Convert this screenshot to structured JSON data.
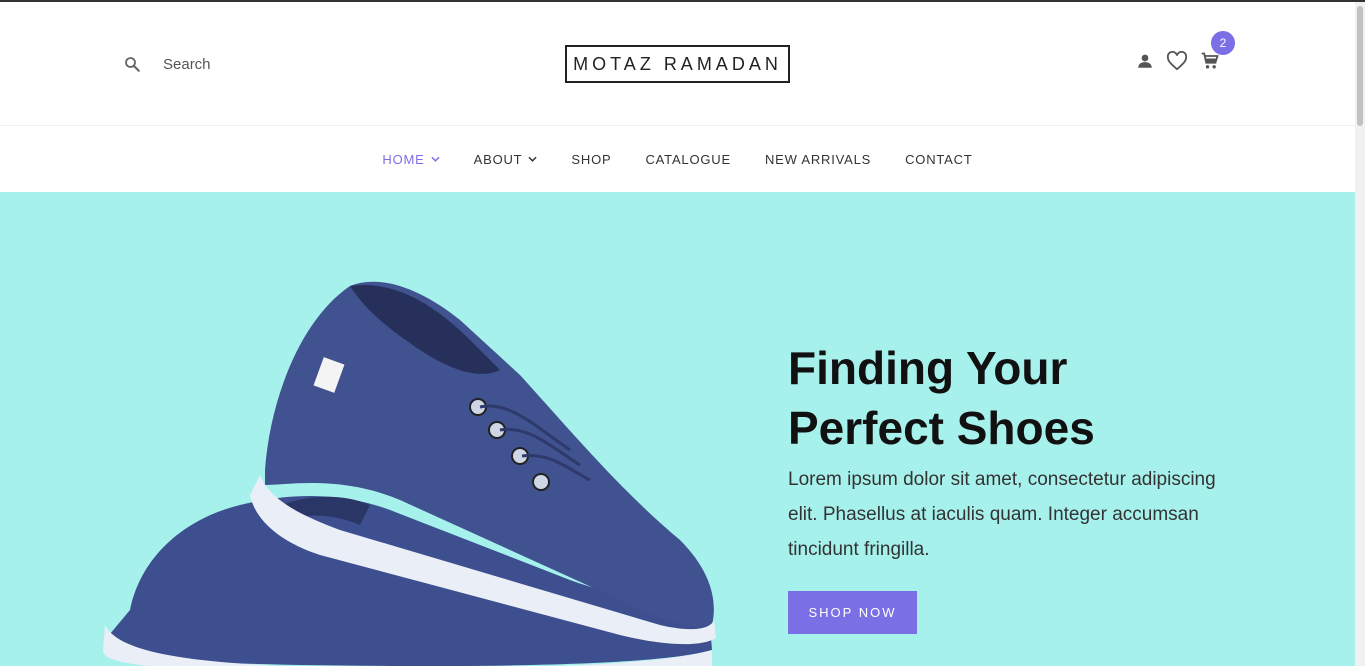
{
  "header": {
    "search_placeholder": "Search",
    "logo": "MOTAZ RAMADAN",
    "cart_count": "2",
    "icons": [
      "search-icon",
      "user-icon",
      "heart-icon",
      "cart-icon"
    ]
  },
  "nav": {
    "items": [
      {
        "label": "HOME",
        "has_dropdown": true,
        "active": true
      },
      {
        "label": "ABOUT",
        "has_dropdown": true,
        "active": false
      },
      {
        "label": "SHOP",
        "has_dropdown": false,
        "active": false
      },
      {
        "label": "CATALOGUE",
        "has_dropdown": false,
        "active": false
      },
      {
        "label": "NEW ARRIVALS",
        "has_dropdown": false,
        "active": false
      },
      {
        "label": "CONTACT",
        "has_dropdown": false,
        "active": false
      }
    ]
  },
  "hero": {
    "title_line1": "Finding Your",
    "title_line2": "Perfect Shoes",
    "description": "Lorem ipsum dolor sit amet, consectetur adipiscing elit. Phasellus at iaculis quam. Integer accumsan tincidunt fringilla.",
    "button_label": "SHOP NOW"
  },
  "colors": {
    "accent": "#7b6fe6",
    "hero_bg": "#a7f1ec",
    "shoe": "#3d4f8f"
  }
}
